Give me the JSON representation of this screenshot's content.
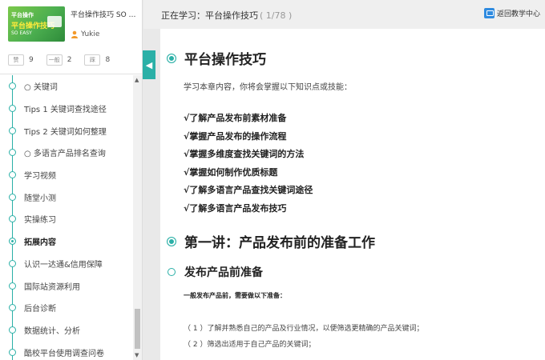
{
  "course": {
    "title": "平台操作技巧 SO E...",
    "author": "Yukie",
    "thumb": {
      "line1": "平台操作",
      "line2": "平台操作技巧",
      "line3": "SO EASY"
    }
  },
  "stats": [
    {
      "icon": "赞",
      "count": "9"
    },
    {
      "icon": "一般",
      "count": "2"
    },
    {
      "icon": "踩",
      "count": "8"
    }
  ],
  "chapters": [
    {
      "label": "○ 关键词",
      "active": false
    },
    {
      "label": "Tips 1 关键词查找途径",
      "active": false
    },
    {
      "label": "Tips 2 关键词如何整理",
      "active": false
    },
    {
      "label": "○ 多语言产品排名查询",
      "active": false
    },
    {
      "label": "学习视频",
      "active": false
    },
    {
      "label": "随堂小测",
      "active": false
    },
    {
      "label": "实操练习",
      "active": false
    },
    {
      "label": "拓展内容",
      "active": true
    },
    {
      "label": "认识一达通&信用保障",
      "active": false
    },
    {
      "label": "国际站资源利用",
      "active": false
    },
    {
      "label": "后台诊断",
      "active": false
    },
    {
      "label": "数据统计、分析",
      "active": false
    },
    {
      "label": "酷校平台使用调查问卷",
      "active": false
    }
  ],
  "topbar": {
    "now_learning": "正在学习：平台操作技巧",
    "progress": "( 1/78 )",
    "back_label": "返回教学中心"
  },
  "content": {
    "title": "平台操作技巧",
    "intro": "学习本章内容，你将会掌握以下知识点或技能：",
    "objectives": [
      "√了解产品发布前素材准备",
      "√掌握产品发布的操作流程",
      "√掌握多维度查找关键词的方法",
      "√掌握如何制作优质标题",
      "√了解多语言产品查找关键词途径",
      "√了解多语言产品发布技巧"
    ],
    "lecture_title": "第一讲：产品发布前的准备工作",
    "section_title": "发布产品前准备",
    "lead": "一般发布产品前，需要做以下准备：",
    "steps": [
      "（ 1 ）了解并熟悉自己的产品及行业情况，以便筛选更精确的产品关键词；",
      "（ 2 ）筛选出适用于自己产品的关键词；"
    ]
  },
  "colors": {
    "accent": "#2bb0a7",
    "link_blue": "#2f8be0"
  }
}
